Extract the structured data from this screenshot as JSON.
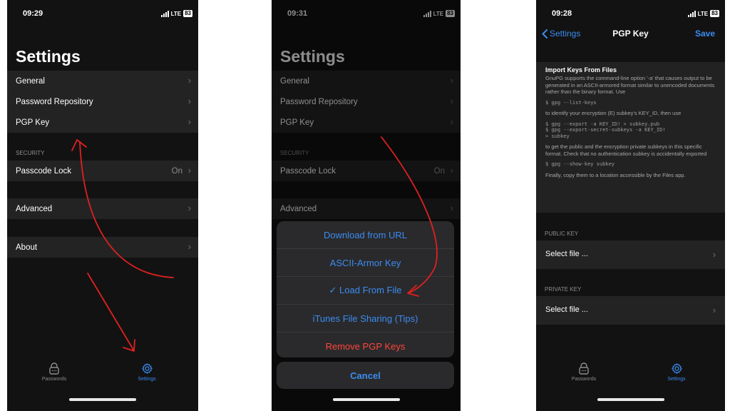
{
  "screens": [
    {
      "status": {
        "time": "09:29",
        "network": "LTE",
        "battery": "83"
      },
      "title": "Settings",
      "general": {
        "label": "General"
      },
      "password_repository": {
        "label": "Password Repository"
      },
      "pgp_key": {
        "label": "PGP Key"
      },
      "security_header": "SECURITY",
      "passcode_lock": {
        "label": "Passcode Lock",
        "value": "On"
      },
      "advanced": {
        "label": "Advanced"
      },
      "about": {
        "label": "About"
      },
      "tabs": {
        "passwords": "Passwords",
        "settings": "Settings"
      }
    },
    {
      "status": {
        "time": "09:31",
        "network": "LTE",
        "battery": "83"
      },
      "title": "Settings",
      "general": {
        "label": "General"
      },
      "password_repository": {
        "label": "Password Repository"
      },
      "pgp_key": {
        "label": "PGP Key"
      },
      "security_header": "SECURITY",
      "passcode_lock": {
        "label": "Passcode Lock",
        "value": "On"
      },
      "advanced": {
        "label": "Advanced"
      },
      "action_sheet": {
        "options": [
          "Download from URL",
          "ASCII-Armor Key",
          "✓ Load From File",
          "iTunes File Sharing (Tips)",
          "Remove PGP Keys"
        ],
        "cancel": "Cancel"
      }
    },
    {
      "status": {
        "time": "09:28",
        "network": "LTE",
        "battery": "83"
      },
      "nav": {
        "back": "Settings",
        "title": "PGP Key",
        "save": "Save"
      },
      "import": {
        "heading": "Import Keys From Files",
        "intro": "GnuPG supports the command-line option '-a' that causes output to be generated in an ASCII-armored format similar to unencoded documents rather than the binary format. Use",
        "cmd_list": "$ gpg --list-keys",
        "identify": "to identify your encryption (E) subkey's KEY_ID, then use",
        "cmd_export": "$ gpg --export -a KEY_ID! > subkey.pub\n$ gpg --export-secret-subkeys -a KEY_ID!\n> subkey",
        "get_public": "to get the public and the encryption private subkeys in this specific format. Check that no authentication subkey is accidentally exported",
        "cmd_show": "$ gpg --show-key subkey",
        "finally": "Finally, copy them to a location accessible by the Files app."
      },
      "public_key": {
        "header": "PUBLIC KEY",
        "select": "Select file ..."
      },
      "private_key": {
        "header": "PRIVATE KEY",
        "select": "Select file ..."
      },
      "tabs": {
        "passwords": "Passwords",
        "settings": "Settings"
      }
    }
  ],
  "colors": {
    "accent": "#3b8cf0",
    "destructive": "#ff453a",
    "annotation": "#e02020"
  }
}
